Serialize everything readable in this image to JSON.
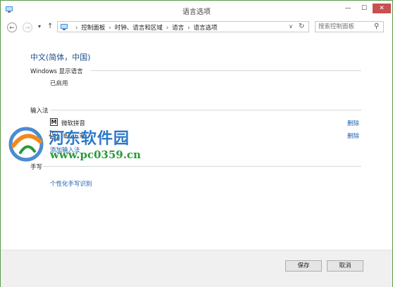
{
  "window": {
    "title": "语言选项",
    "min_glyph": "—",
    "max_glyph": "☐",
    "close_glyph": "✕"
  },
  "nav": {
    "back_glyph": "←",
    "forward_glyph": "→",
    "recent_glyph": "▾",
    "up_glyph": "↑",
    "dropdown_glyph": "∨",
    "refresh_glyph": "↻"
  },
  "breadcrumb": {
    "separator": "›",
    "items": [
      "控制面板",
      "时钟、语言和区域",
      "语言",
      "语言选项"
    ]
  },
  "search": {
    "placeholder": "搜索控制面板",
    "icon_glyph": "⚲"
  },
  "main": {
    "language_title": "中文(简体，中国)",
    "display_language": {
      "heading": "Windows 显示语言",
      "status": "已启用"
    },
    "input_method": {
      "heading": "输入法",
      "items": [
        {
          "icon_text": "M",
          "label": "微软拼音",
          "action": "删除"
        },
        {
          "icon_text": "五",
          "label": "微软五笔",
          "action": "删除"
        }
      ],
      "add_link": "添加输入法"
    },
    "handwriting": {
      "heading": "手写",
      "link": "个性化手写识别"
    }
  },
  "watermark": {
    "name": "河东软件园",
    "url": "www.pc0359.cn"
  },
  "footer": {
    "save_label": "保存",
    "cancel_label": "取消"
  },
  "colors": {
    "link": "#1a5fb4",
    "title_blue": "#1e4e8c",
    "close_red": "#c75050",
    "frame_green": "#5c9b4a"
  }
}
